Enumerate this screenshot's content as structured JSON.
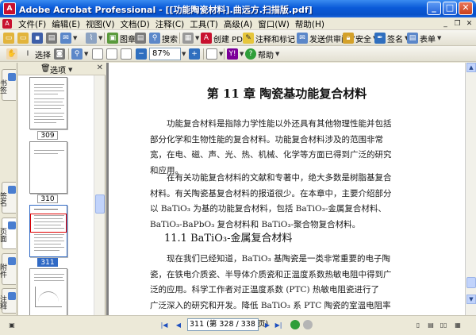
{
  "window": {
    "title": "Adobe Acrobat Professional - [[功能陶瓷材料].曲远方.扫描版.pdf]"
  },
  "menu": [
    "文件(F)",
    "编辑(E)",
    "视图(V)",
    "文档(D)",
    "注释(C)",
    "工具(T)",
    "高级(A)",
    "窗口(W)",
    "帮助(H)"
  ],
  "toolbar1": {
    "picture_label": "图章",
    "search_label": "搜索",
    "create_pdf_label": "创建 PDF",
    "comment_label": "注释和标记",
    "review_label": "发送供审阅",
    "security_label": "安全",
    "sign_label": "签名",
    "forms_label": "表单"
  },
  "toolbar2": {
    "select_label": "选择",
    "zoom_value": "87%",
    "help_label": "帮助"
  },
  "sidebar": {
    "tabs": [
      "书签",
      "签名",
      "页面",
      "附件",
      "注释"
    ],
    "options_label": "选项"
  },
  "thumbnails": [
    {
      "label": "309",
      "selected": false
    },
    {
      "label": "310",
      "selected": false
    },
    {
      "label": "311",
      "selected": true
    }
  ],
  "page": {
    "chapter_title": "第 11 章   陶瓷基功能复合材料",
    "para1": [
      "功能复合材料是指除力学性能以外还具有其他物理性能并包括",
      "部分化学和生物性能的复合材料。功能复合材料涉及的范围非常",
      "宽，在电、磁、声、光、热、机械、化学等方面已得到广泛的研究",
      "和应用。"
    ],
    "para2": [
      "在有关功能复合材料的文献和专著中，绝大多数是树脂基复合",
      "材料。有关陶瓷基复合材料的报道很少。在本章中，主要介绍部分",
      "以 BaTiO₃ 为基的功能复合材料，包括 BaTiO₃-金属复合材料、",
      "BaTiO₃-BaPbO₃ 复合材料和 BaTiO₃-聚合物复合材料。"
    ],
    "section_title": "11.1   BaTiO₃-金属复合材料",
    "para3": [
      "现在我们已经知道，BaTiO₃ 基陶瓷是一类非常重要的电子陶",
      "瓷，在铁电介质瓷、半导体介质瓷和正温度系数热敏电阻中得到广",
      "泛的应用。科学工作者对正温度系数 (PTC) 热敏电阻瓷进行了",
      "广泛深入的研究和开发。降低 BaTiO₃ 系 PTC 陶瓷的室温电阻率"
    ]
  },
  "statusbar": {
    "page_indicator": "311 (第 328 / 338 页)"
  }
}
